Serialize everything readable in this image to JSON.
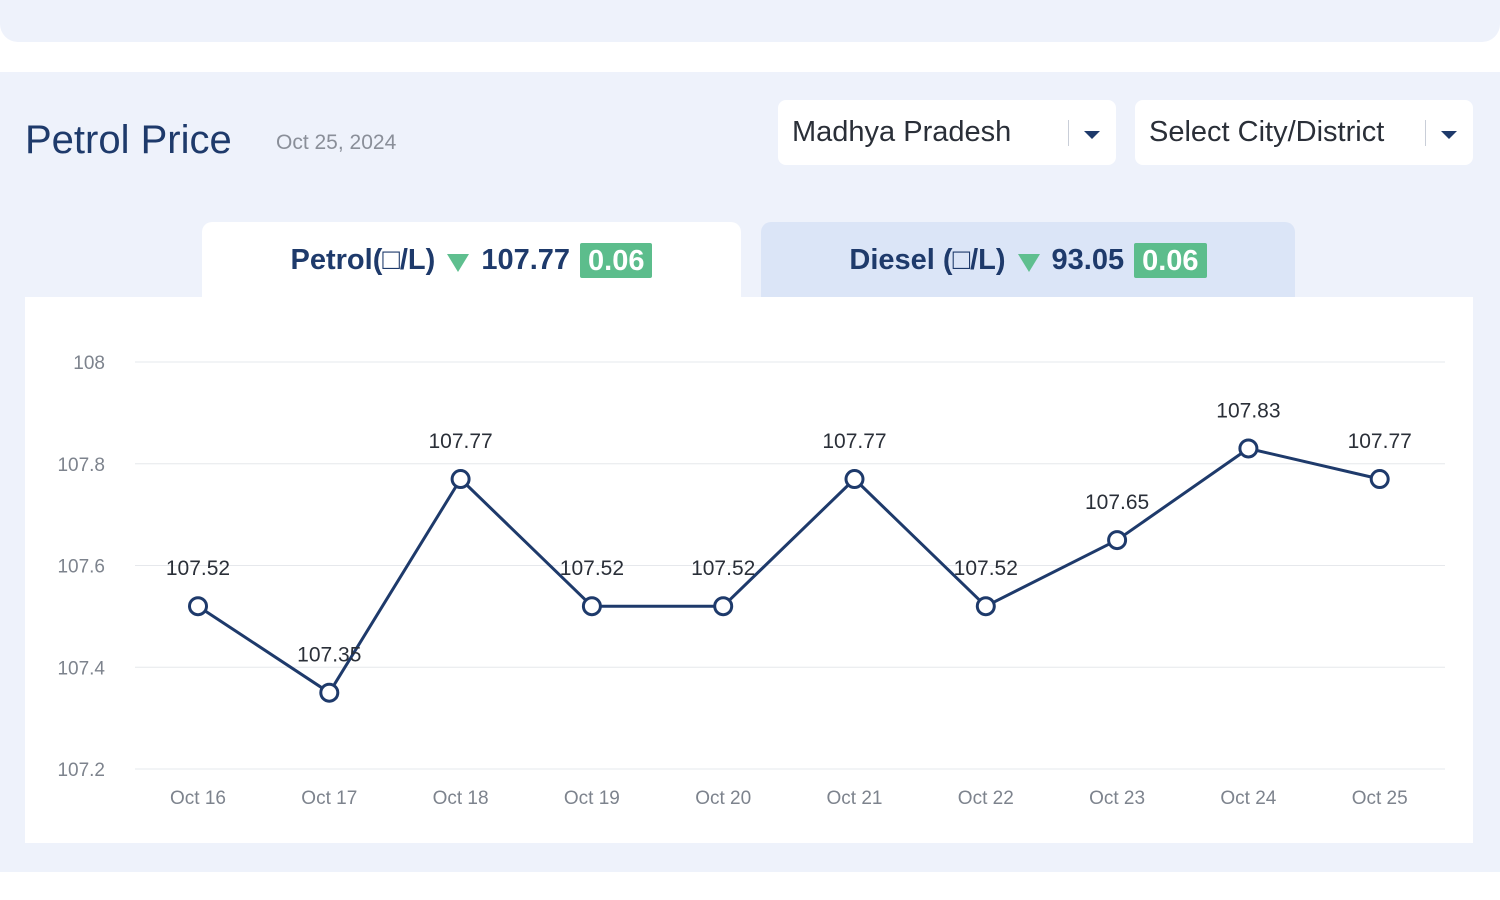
{
  "header": {
    "title": "Petrol Price",
    "date": "Oct 25, 2024"
  },
  "filters": {
    "state": "Madhya Pradesh",
    "city": "Select City/District"
  },
  "tabs": [
    {
      "label": "Petrol(□/L)",
      "price": "107.77",
      "change": "0.06",
      "trend_icon": "down-triangle-icon",
      "active": true
    },
    {
      "label": "Diesel (□/L)",
      "price": "93.05",
      "change": "0.06",
      "trend_icon": "down-triangle-icon",
      "active": false
    }
  ],
  "colors": {
    "line": "#1e3a6b",
    "trend_down": "#5fbf8f",
    "change_badge": "#5cbd8c",
    "panel_bg": "#eef2fb",
    "tab_inactive": "#dbe5f7"
  },
  "chart_data": {
    "type": "line",
    "categories": [
      "Oct 16",
      "Oct 17",
      "Oct 18",
      "Oct 19",
      "Oct 20",
      "Oct 21",
      "Oct 22",
      "Oct 23",
      "Oct 24",
      "Oct 25"
    ],
    "values": [
      107.52,
      107.35,
      107.77,
      107.52,
      107.52,
      107.77,
      107.52,
      107.65,
      107.83,
      107.77
    ],
    "data_labels": [
      "107.52",
      "107.35",
      "107.77",
      "107.52",
      "107.52",
      "107.77",
      "107.52",
      "107.65",
      "107.83",
      "107.77"
    ],
    "y_ticks": [
      "107.2",
      "107.4",
      "107.6",
      "107.8",
      "108"
    ],
    "ylim": [
      107.2,
      108
    ],
    "grid": true,
    "legend": false,
    "markers": "hollow-circle"
  }
}
